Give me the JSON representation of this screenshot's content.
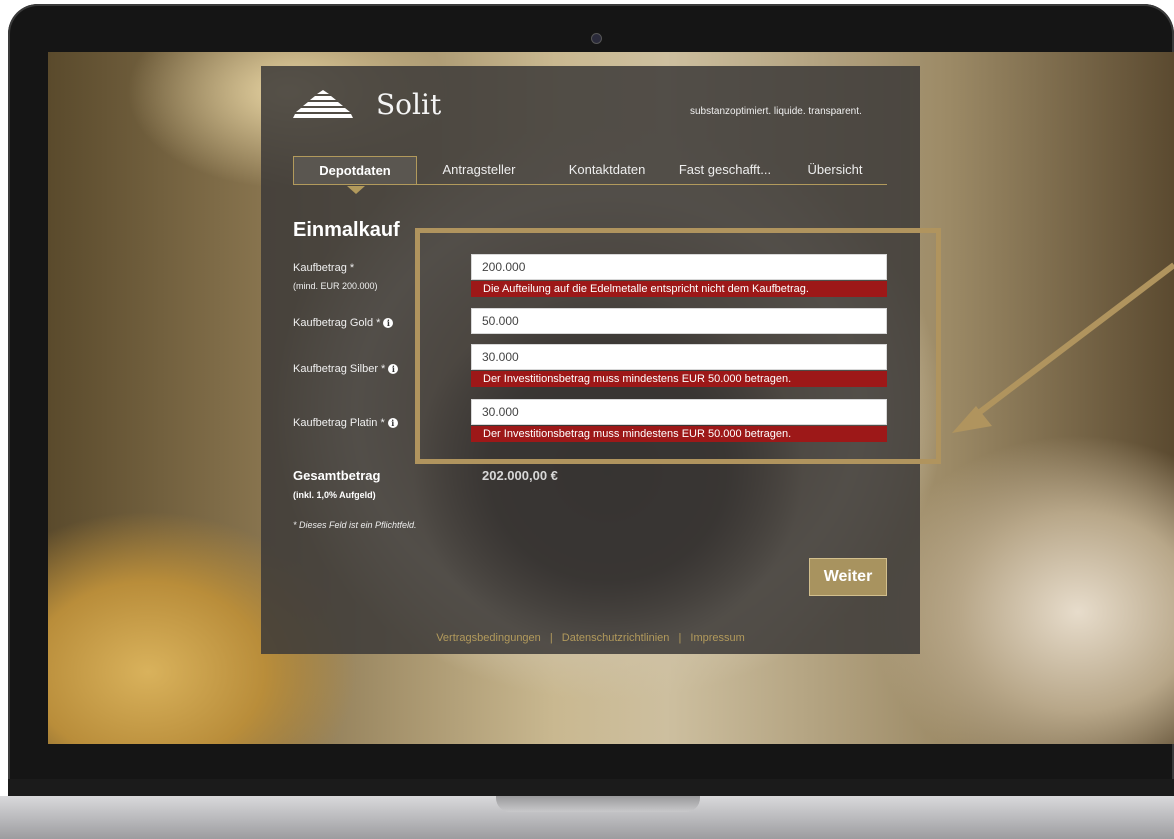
{
  "brand": {
    "name": "Solit",
    "tagline": "substanzoptimiert. liquide. transparent."
  },
  "tabs": [
    {
      "label": "Depotdaten",
      "active": true
    },
    {
      "label": "Antragsteller",
      "active": false
    },
    {
      "label": "Kontaktdaten",
      "active": false
    },
    {
      "label": "Fast geschafft...",
      "active": false
    },
    {
      "label": "Übersicht",
      "active": false
    }
  ],
  "form": {
    "title": "Einmalkauf",
    "fields": [
      {
        "label": "Kaufbetrag *",
        "sublabel": "(mind. EUR 200.000)",
        "value": "200.000",
        "error": "Die Aufteilung auf die Edelmetalle entspricht nicht dem Kaufbetrag."
      },
      {
        "label": "Kaufbetrag Gold *",
        "value": "50.000"
      },
      {
        "label": "Kaufbetrag Silber *",
        "value": "30.000",
        "error": "Der Investitionsbetrag muss mindestens EUR 50.000 betragen."
      },
      {
        "label": "Kaufbetrag Platin *",
        "value": "30.000",
        "error": "Der Investitionsbetrag muss mindestens EUR 50.000 betragen."
      }
    ],
    "total": {
      "label": "Gesamtbetrag",
      "sublabel": "(inkl. 1,0% Aufgeld)",
      "value": "202.000,00 €"
    },
    "required_note": "* Dieses Feld ist ein Pflichtfeld.",
    "next_label": "Weiter"
  },
  "footer": {
    "links": [
      "Vertragsbedingungen",
      "Datenschutzrichtlinien",
      "Impressum"
    ],
    "separator": "|"
  },
  "colors": {
    "accent": "#b29a5c",
    "error": "#9d1818",
    "panel": "#3c3a38"
  },
  "icons": {
    "info": "info-circle-icon",
    "logo": "stacked-bars-pyramid-icon"
  }
}
